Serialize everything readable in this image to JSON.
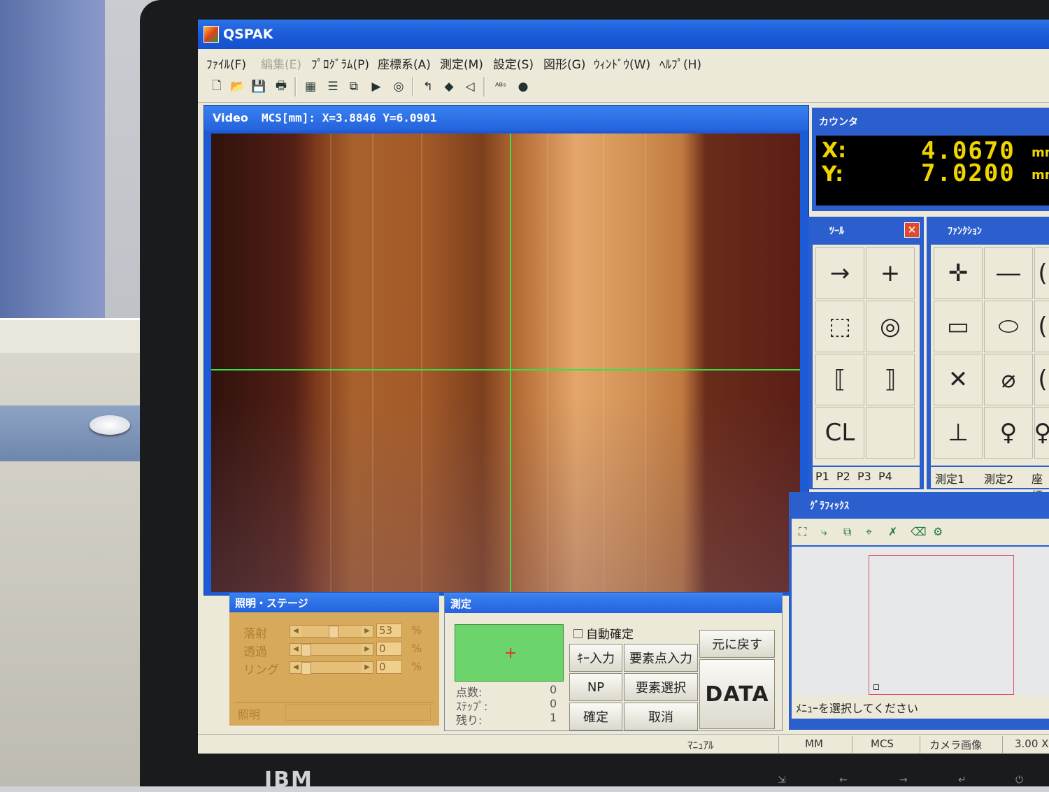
{
  "app": {
    "title": "QSPAK"
  },
  "menu": [
    "ﾌｧｲﾙ(F)",
    "編集(E)",
    "ﾌﾟﾛｸﾞﾗﾑ(P)",
    "座標系(A)",
    "測定(M)",
    "設定(S)",
    "図形(G)",
    "ｳｨﾝﾄﾞｳ(W)",
    "ﾍﾙﾌﾟ(H)"
  ],
  "video": {
    "title": "Video",
    "coords": "MCS[mm]: X=3.8846 Y=6.0901"
  },
  "counter": {
    "title": "カウンタ",
    "x_label": "X:",
    "x_value": "4.0670",
    "x_unit": "mm",
    "y_label": "Y:",
    "y_value": "7.0200",
    "y_unit": "mm"
  },
  "tool": {
    "title": "ﾂｰﾙ",
    "tabs": [
      "P1",
      "P2",
      "P3",
      "P4"
    ],
    "cl_label": "CL"
  },
  "function": {
    "title": "ﾌｧﾝｸｼｮﾝ",
    "tabs": [
      "測定1",
      "測定2",
      "座標系"
    ]
  },
  "lighting": {
    "title": "照明・ステージ",
    "rows": [
      {
        "label": "落射",
        "value": "53",
        "unit": "%",
        "fraction": 0.53
      },
      {
        "label": "透過",
        "value": "0",
        "unit": "%",
        "fraction": 0
      },
      {
        "label": "リング",
        "value": "0",
        "unit": "%",
        "fraction": 0
      }
    ],
    "footer": "照明"
  },
  "measure": {
    "title": "測定",
    "auto_confirm": "自動確定",
    "stats": [
      {
        "label": "点数:",
        "value": "0"
      },
      {
        "label": "ｽﾃｯﾌﾟ:",
        "value": "0"
      },
      {
        "label": "残り:",
        "value": "1"
      }
    ],
    "buttons": {
      "key_input": "ｷｰ入力",
      "element_point": "要素点入力",
      "undo": "元に戻す",
      "np": "NP",
      "element_select": "要素選択",
      "data": "DATA",
      "confirm": "確定",
      "cancel": "取消"
    }
  },
  "graphics": {
    "title": "ｸﾞﾗﾌｨｯｸｽ",
    "status": "ﾒﾆｭｰを選択してください"
  },
  "statusbar": {
    "mode": "ﾏﾆｭｱﾙ",
    "unit": "MM",
    "coord": "MCS",
    "source": "カメラ画像",
    "zoom": "3.00 X"
  },
  "monitor": {
    "brand": "IBM"
  },
  "colors": {
    "crosshair": "#38e048",
    "counter_text": "#f0d400",
    "titlebar": "#2462dc"
  }
}
